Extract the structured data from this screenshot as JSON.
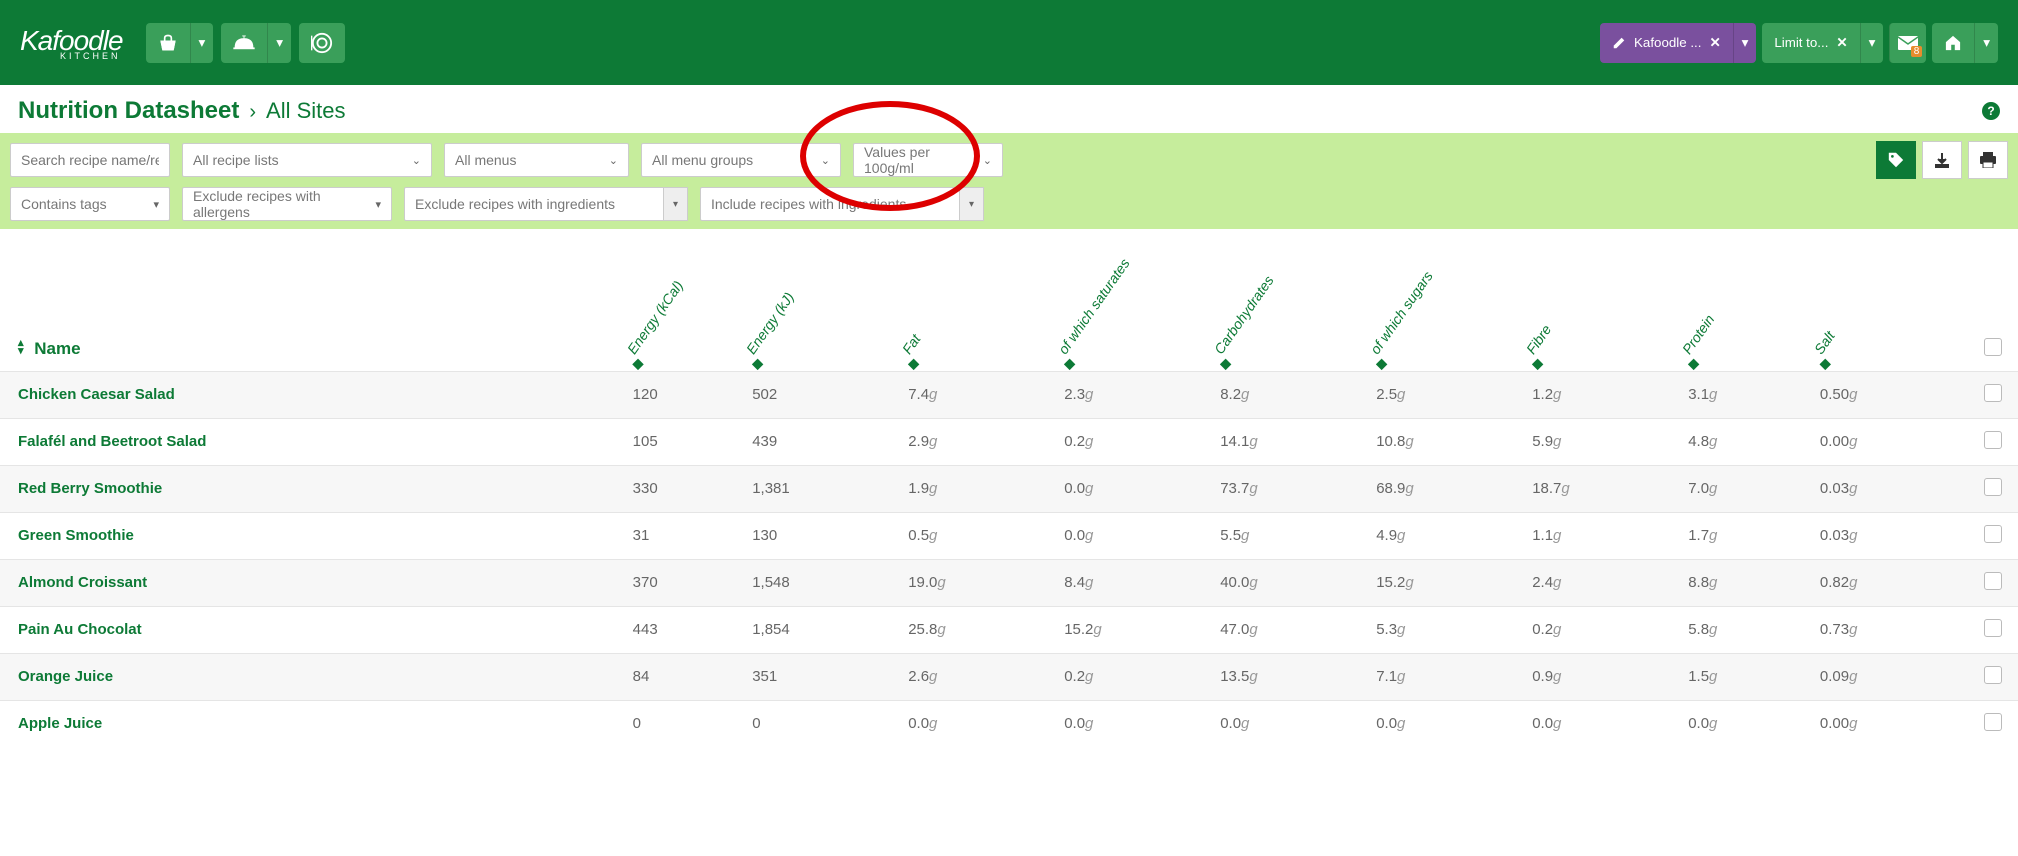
{
  "header": {
    "logo_main": "Kafoodle",
    "logo_sub": "KITCHEN",
    "purple_label": "Kafoodle ...",
    "limit_label": "Limit to...",
    "mail_badge": "8"
  },
  "breadcrumb": {
    "title": "Nutrition Datasheet",
    "sub": "All Sites"
  },
  "filters": {
    "search_placeholder": "Search recipe name/refe",
    "recipe_lists": "All recipe lists",
    "menus": "All menus",
    "menu_groups": "All menu groups",
    "values_per": "Values per 100g/ml",
    "contains_tags": "Contains tags",
    "exclude_allergens": "Exclude recipes with allergens",
    "exclude_ingredients": "Exclude recipes with ingredients",
    "include_ingredients": "Include recipes with ingredients"
  },
  "columns": {
    "name": "Name",
    "c1": "Energy (kCal)",
    "c2": "Energy (kJ)",
    "c3": "Fat",
    "c4": "of which saturates",
    "c5": "Carbohydrates",
    "c6": "of which sugars",
    "c7": "Fibre",
    "c8": "Protein",
    "c9": "Salt"
  },
  "rows": [
    {
      "name": "Chicken Caesar Salad",
      "v": [
        "120",
        "502",
        "7.4",
        "2.3",
        "8.2",
        "2.5",
        "1.2",
        "3.1",
        "0.50"
      ]
    },
    {
      "name": "Falafél and Beetroot Salad",
      "v": [
        "105",
        "439",
        "2.9",
        "0.2",
        "14.1",
        "10.8",
        "5.9",
        "4.8",
        "0.00"
      ]
    },
    {
      "name": "Red Berry Smoothie",
      "v": [
        "330",
        "1,381",
        "1.9",
        "0.0",
        "73.7",
        "68.9",
        "18.7",
        "7.0",
        "0.03"
      ]
    },
    {
      "name": "Green Smoothie",
      "v": [
        "31",
        "130",
        "0.5",
        "0.0",
        "5.5",
        "4.9",
        "1.1",
        "1.7",
        "0.03"
      ]
    },
    {
      "name": "Almond Croissant",
      "v": [
        "370",
        "1,548",
        "19.0",
        "8.4",
        "40.0",
        "15.2",
        "2.4",
        "8.8",
        "0.82"
      ]
    },
    {
      "name": "Pain Au Chocolat",
      "v": [
        "443",
        "1,854",
        "25.8",
        "15.2",
        "47.0",
        "5.3",
        "0.2",
        "5.8",
        "0.73"
      ]
    },
    {
      "name": "Orange Juice",
      "v": [
        "84",
        "351",
        "2.6",
        "0.2",
        "13.5",
        "7.1",
        "0.9",
        "1.5",
        "0.09"
      ]
    },
    {
      "name": "Apple Juice",
      "v": [
        "0",
        "0",
        "0.0",
        "0.0",
        "0.0",
        "0.0",
        "0.0",
        "0.0",
        "0.00"
      ]
    }
  ],
  "unit_g": "g"
}
